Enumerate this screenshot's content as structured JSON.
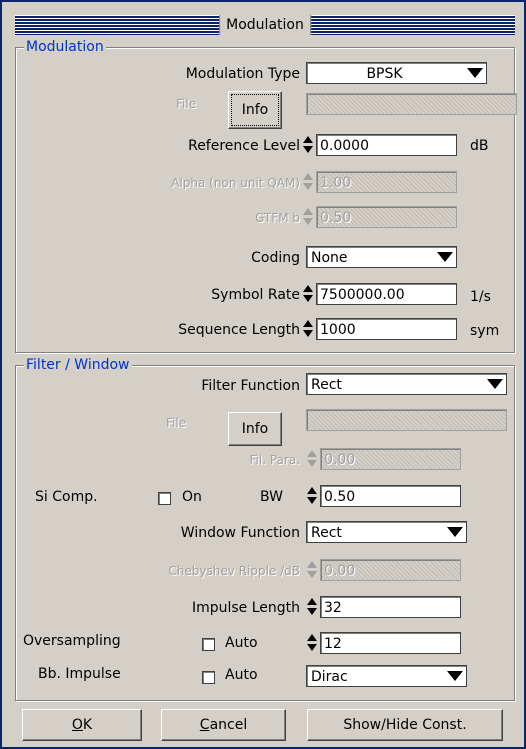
{
  "window": {
    "title": "Modulation"
  },
  "modulation": {
    "group_title": "Modulation",
    "type_label": "Modulation Type",
    "type_value": "BPSK",
    "file_label": "File",
    "info_button": "Info",
    "ref_level_label": "Reference Level",
    "ref_level_value": "0.0000",
    "ref_level_unit": "dB",
    "alpha_label": "Alpha (non unit QAM)",
    "alpha_value": "1.00",
    "gtfm_label": "GTFM b",
    "gtfm_value": "0.50",
    "coding_label": "Coding",
    "coding_value": "None",
    "symbol_rate_label": "Symbol Rate",
    "symbol_rate_value": "7500000.00",
    "symbol_rate_unit": "1/s",
    "seq_len_label": "Sequence Length",
    "seq_len_value": "1000",
    "seq_len_unit": "sym"
  },
  "filter": {
    "group_title": "Filter / Window",
    "function_label": "Filter Function",
    "function_value": "Rect",
    "file_label": "File",
    "info_button": "Info",
    "fil_para_label": "Fil. Para.",
    "fil_para_value": "0.00",
    "si_comp_label": "Si Comp.",
    "si_on_label": "On",
    "bw_label": "BW",
    "bw_value": "0.50",
    "window_function_label": "Window Function",
    "window_function_value": "Rect",
    "cheby_label": "Chebyshev Ripple /dB",
    "cheby_value": "0.00",
    "impulse_len_label": "Impulse Length",
    "impulse_len_value": "32",
    "oversampling_label": "Oversampling",
    "oversampling_auto_label": "Auto",
    "oversampling_value": "12",
    "bb_impulse_label": "Bb. Impulse",
    "bb_auto_label": "Auto",
    "bb_impulse_value": "Dirac"
  },
  "buttons": {
    "ok_underline": "O",
    "ok_rest": "K",
    "cancel_underline": "C",
    "cancel_rest": "ancel",
    "show_hide": "Show/Hide Const."
  }
}
